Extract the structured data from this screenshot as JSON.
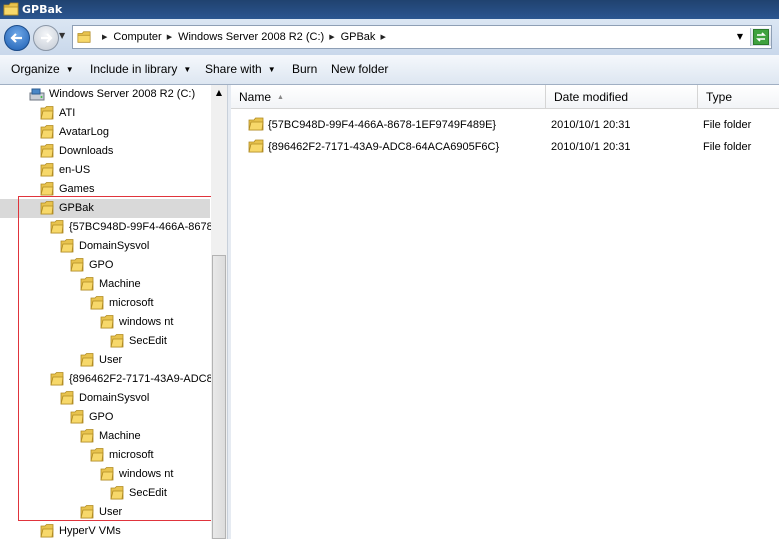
{
  "window": {
    "title": "GPBak",
    "icon": "folder-icon"
  },
  "address": {
    "crumbs": [
      "Computer",
      "Windows Server 2008 R2 (C:)",
      "GPBak"
    ],
    "icons": {
      "back": "back-arrow-icon",
      "forward": "forward-arrow-icon",
      "refresh": "refresh-icon"
    }
  },
  "toolbar": {
    "organize": "Organize",
    "include_in_library": "Include in library",
    "share_with": "Share with",
    "burn": "Burn",
    "new_folder": "New folder"
  },
  "nav_tree": {
    "drive": "Windows Server 2008 R2 (C:)",
    "items": [
      {
        "label": "ATI"
      },
      {
        "label": "AvatarLog"
      },
      {
        "label": "Downloads"
      },
      {
        "label": "en-US"
      },
      {
        "label": "Games"
      },
      {
        "label": "GPBak",
        "selected": true
      },
      {
        "label": "{57BC948D-99F4-466A-8678"
      },
      {
        "label": "DomainSysvol"
      },
      {
        "label": "GPO"
      },
      {
        "label": "Machine"
      },
      {
        "label": "microsoft"
      },
      {
        "label": "windows nt"
      },
      {
        "label": "SecEdit"
      },
      {
        "label": "User"
      },
      {
        "label": "{896462F2-7171-43A9-ADC8"
      },
      {
        "label": "DomainSysvol"
      },
      {
        "label": "GPO"
      },
      {
        "label": "Machine"
      },
      {
        "label": "microsoft"
      },
      {
        "label": "windows nt"
      },
      {
        "label": "SecEdit"
      },
      {
        "label": "User"
      },
      {
        "label": "HyperV VMs"
      }
    ]
  },
  "columns": {
    "name": "Name",
    "date_modified": "Date modified",
    "type": "Type"
  },
  "files": [
    {
      "name": "{57BC948D-99F4-466A-8678-1EF9749F489E}",
      "date": "2010/10/1 20:31",
      "type": "File folder"
    },
    {
      "name": "{896462F2-7171-43A9-ADC8-64ACA6905F6C}",
      "date": "2010/10/1 20:31",
      "type": "File folder"
    }
  ],
  "colors": {
    "titlebar": "#2b5691",
    "highlight_box": "#e0343c",
    "selected_row": "#d9d9d9"
  }
}
